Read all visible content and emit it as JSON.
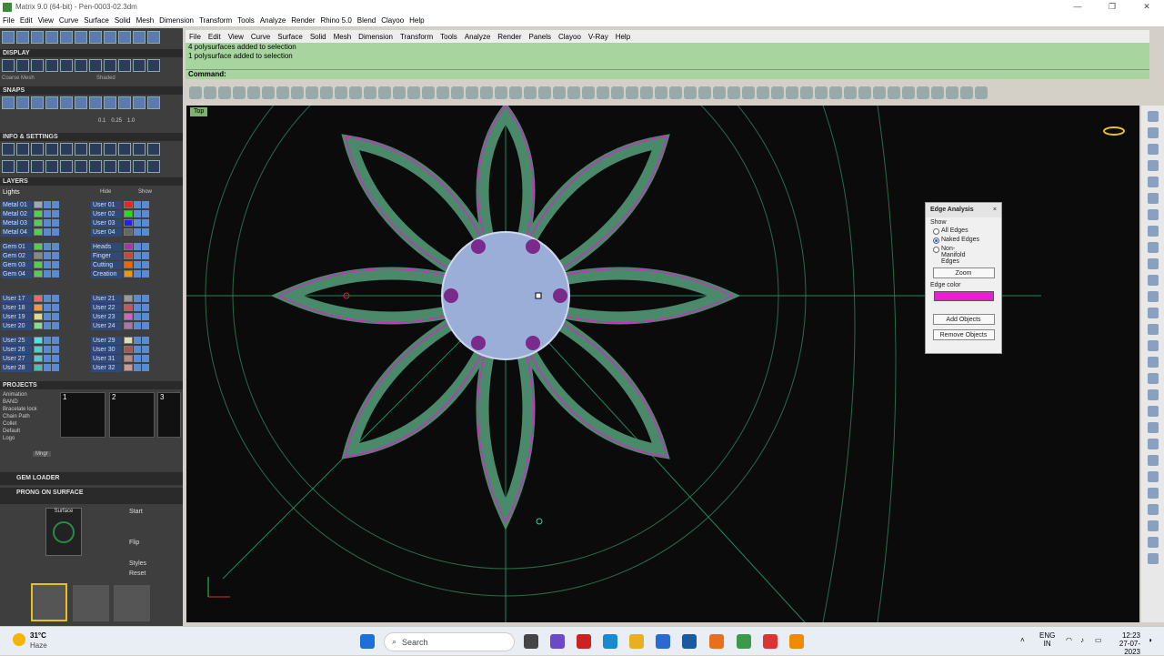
{
  "window": {
    "title": "Matrix 9.0 (64-bit) - Pen-0003-02.3dm"
  },
  "outer_menu": [
    "File",
    "Edit",
    "View",
    "Curve",
    "Surface",
    "Solid",
    "Mesh",
    "Dimension",
    "Transform",
    "Tools",
    "Analyze",
    "Render",
    "Rhino 5.0",
    "Blend",
    "Clayoo",
    "Help"
  ],
  "left": {
    "display": "DISPLAY",
    "coarse": "Coarse Mesh",
    "shaded": "Shaded",
    "snaps": "SNAPS",
    "snap_vals": [
      "0.1",
      "0.25",
      "1.0"
    ],
    "info": "INFO & SETTINGS",
    "layers": "LAYERS",
    "lights": "Lights",
    "hide": "Hide",
    "show": "Show",
    "layer_left": [
      "Metal 01",
      "Metal 02",
      "Metal 03",
      "Metal 04",
      "Gem 01",
      "Gem 02",
      "Gem 03",
      "Gem 04",
      "User 17",
      "User 18",
      "User 19",
      "User 20",
      "User 25",
      "User 26",
      "User 27",
      "User 28"
    ],
    "layer_right": [
      "User 01",
      "User 02",
      "User 03",
      "User 04",
      "Heads",
      "Finger",
      "Cutting",
      "Creation",
      "User 21",
      "User 22",
      "User 23",
      "User 24",
      "User 29",
      "User 30",
      "User 31",
      "User 32"
    ],
    "projects": "PROJECTS",
    "project_items": [
      "Animation",
      "BAND",
      "Bracelate lock",
      "Chain Path",
      "Collet",
      "Default",
      "Logo"
    ],
    "project_nums": [
      "1",
      "2",
      "3"
    ],
    "mngr": "Mngr",
    "gem_loader": "GEM LOADER",
    "prong": "PRONG ON SURFACE",
    "surface": "Surface",
    "opts": [
      "Start",
      "Flip",
      "Styles",
      "Reset"
    ]
  },
  "rhino_menu": [
    "File",
    "Edit",
    "View",
    "Curve",
    "Surface",
    "Solid",
    "Mesh",
    "Dimension",
    "Transform",
    "Tools",
    "Analyze",
    "Render",
    "Panels",
    "Clayoo",
    "V-Ray",
    "Help"
  ],
  "command": {
    "history": [
      "4 polysurfaces added to selection",
      "1 polysurface added to selection"
    ],
    "prompt": "Command:"
  },
  "viewport": {
    "label": "Top"
  },
  "edge_dialog": {
    "title": "Edge Analysis",
    "show": "Show",
    "options": [
      "All Edges",
      "Naked Edges",
      "Non-Manifold Edges"
    ],
    "selected": "Naked Edges",
    "zoom": "Zoom",
    "edge_color_label": "Edge color",
    "edge_color": "#e81ed0",
    "add": "Add Objects",
    "remove": "Remove Objects"
  },
  "taskbar": {
    "temp": "31°C",
    "cond": "Haze",
    "search": "Search",
    "lang1": "ENG",
    "lang2": "IN",
    "time": "12:23",
    "date": "27-07-2023"
  }
}
